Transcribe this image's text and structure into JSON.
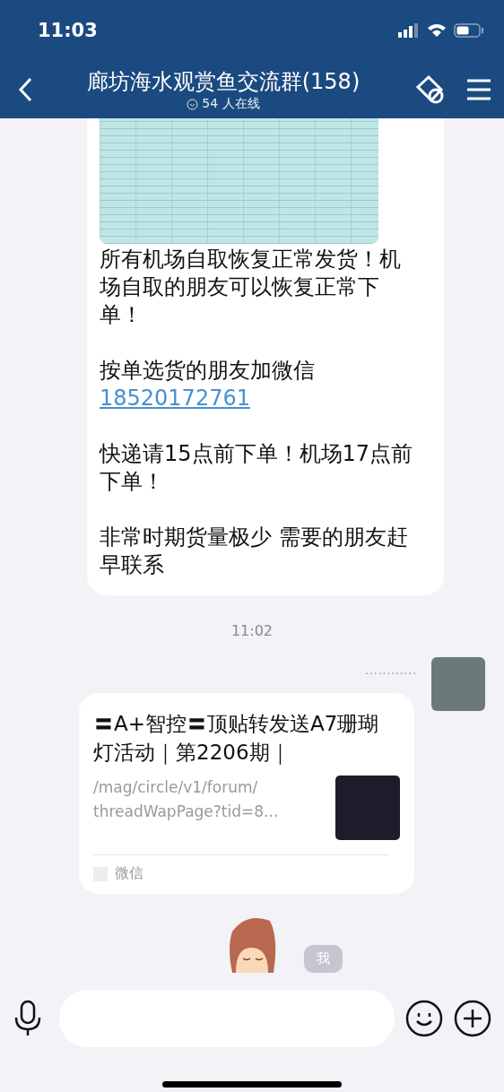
{
  "status_bar": {
    "time": "11:03"
  },
  "header": {
    "title": "廊坊海水观赏鱼交流群(158)",
    "online": "54 人在线"
  },
  "messages": [
    {
      "kind": "text",
      "image": true,
      "paragraphs": [
        {
          "text": "所有机场自取恢复正常发货！机场自取的朋友可以恢复正常下单！"
        },
        {
          "text": "按单选货的朋友加微信",
          "link": "18520172761"
        },
        {
          "text": "快递请15点前下单！机场17点前下单！"
        },
        {
          "text": "非常时期货量极少 需要的朋友赶早联系"
        }
      ]
    },
    {
      "kind": "time",
      "text": "11:02"
    },
    {
      "kind": "link_card",
      "sender": "............",
      "title": "〓A+智控〓顶贴转发送A7珊瑚灯活动｜第2206期｜",
      "url_lines": [
        "/mag/circle/v1/forum/",
        "threadWapPage?tid=8..."
      ],
      "source": "微信"
    },
    {
      "kind": "sticker",
      "label": "我"
    }
  ]
}
